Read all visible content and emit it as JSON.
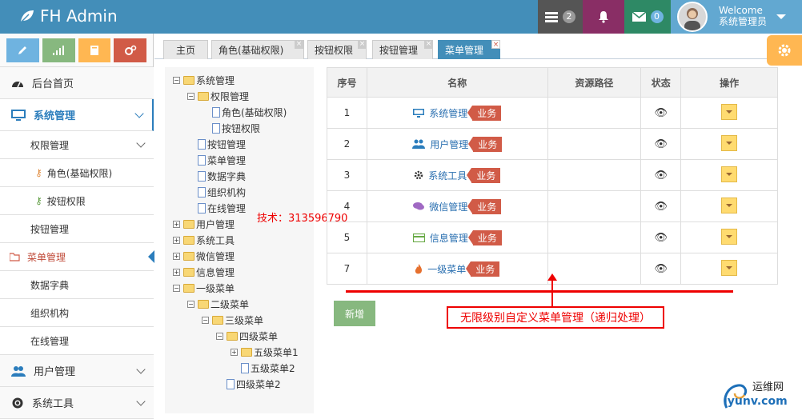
{
  "app": {
    "title": "FH Admin"
  },
  "header": {
    "tasks_count": "2",
    "messages_count": "0",
    "welcome": "Welcome",
    "username": "系统管理员"
  },
  "sidebar": {
    "shortcut_colors": [
      "#82af6f",
      "#87b87f",
      "#ffb752",
      "#d15b47"
    ],
    "items": [
      {
        "label": "后台首页",
        "icon": "dashboard-icon"
      },
      {
        "label": "系统管理",
        "icon": "desktop-icon"
      },
      {
        "label": "权限管理"
      },
      {
        "label": "角色(基础权限)"
      },
      {
        "label": "按钮权限"
      },
      {
        "label": "按钮管理"
      },
      {
        "label": "菜单管理"
      },
      {
        "label": "数据字典"
      },
      {
        "label": "组织机构"
      },
      {
        "label": "在线管理"
      },
      {
        "label": "用户管理",
        "icon": "users-icon"
      },
      {
        "label": "系统工具",
        "icon": "cogs-icon"
      }
    ]
  },
  "tabs": [
    {
      "label": "主页"
    },
    {
      "label": "角色(基础权限)"
    },
    {
      "label": "按钮权限"
    },
    {
      "label": "按钮管理"
    },
    {
      "label": "菜单管理"
    }
  ],
  "tree": [
    {
      "label": "系统管理",
      "toggle": "−",
      "kind": "folder-open"
    },
    {
      "label": "权限管理",
      "toggle": "−",
      "kind": "folder-open"
    },
    {
      "label": "角色(基础权限)",
      "toggle": "",
      "kind": "doc"
    },
    {
      "label": "按钮权限",
      "toggle": "",
      "kind": "doc"
    },
    {
      "label": "按钮管理",
      "toggle": "",
      "kind": "doc"
    },
    {
      "label": "菜单管理",
      "toggle": "",
      "kind": "doc"
    },
    {
      "label": "数据字典",
      "toggle": "",
      "kind": "doc"
    },
    {
      "label": "组织机构",
      "toggle": "",
      "kind": "doc"
    },
    {
      "label": "在线管理",
      "toggle": "",
      "kind": "doc"
    },
    {
      "label": "用户管理",
      "toggle": "+",
      "kind": "folder"
    },
    {
      "label": "系统工具",
      "toggle": "+",
      "kind": "folder"
    },
    {
      "label": "微信管理",
      "toggle": "+",
      "kind": "folder"
    },
    {
      "label": "信息管理",
      "toggle": "+",
      "kind": "folder"
    },
    {
      "label": "一级菜单",
      "toggle": "−",
      "kind": "folder-open"
    },
    {
      "label": "二级菜单",
      "toggle": "−",
      "kind": "folder-open"
    },
    {
      "label": "三级菜单",
      "toggle": "−",
      "kind": "folder-open"
    },
    {
      "label": "四级菜单",
      "toggle": "−",
      "kind": "folder-open"
    },
    {
      "label": "五级菜单1",
      "toggle": "+",
      "kind": "folder"
    },
    {
      "label": "五级菜单2",
      "toggle": "",
      "kind": "doc"
    },
    {
      "label": "四级菜单2",
      "toggle": "",
      "kind": "doc"
    }
  ],
  "watermark": "技术：313596790",
  "table": {
    "headers": [
      "序号",
      "名称",
      "资源路径",
      "状态",
      "操作"
    ],
    "rows": [
      {
        "no": "1",
        "name": "系统管理",
        "icon": "desktop-icon",
        "tag": "业务",
        "path": ""
      },
      {
        "no": "2",
        "name": "用户管理",
        "icon": "users-icon",
        "tag": "业务",
        "path": ""
      },
      {
        "no": "3",
        "name": "系统工具",
        "icon": "cog-icon",
        "tag": "业务",
        "path": ""
      },
      {
        "no": "4",
        "name": "微信管理",
        "icon": "comments-icon",
        "tag": "业务",
        "path": ""
      },
      {
        "no": "5",
        "name": "信息管理",
        "icon": "credit-card-icon",
        "tag": "业务",
        "path": ""
      },
      {
        "no": "7",
        "name": "一级菜单",
        "icon": "fire-icon",
        "tag": "业务",
        "path": ""
      }
    ]
  },
  "add_button": "新增",
  "annotation": "无限级别自定义菜单管理（递归处理）",
  "site_logo": {
    "cn": "运维网",
    "url": "iyunv.com"
  }
}
